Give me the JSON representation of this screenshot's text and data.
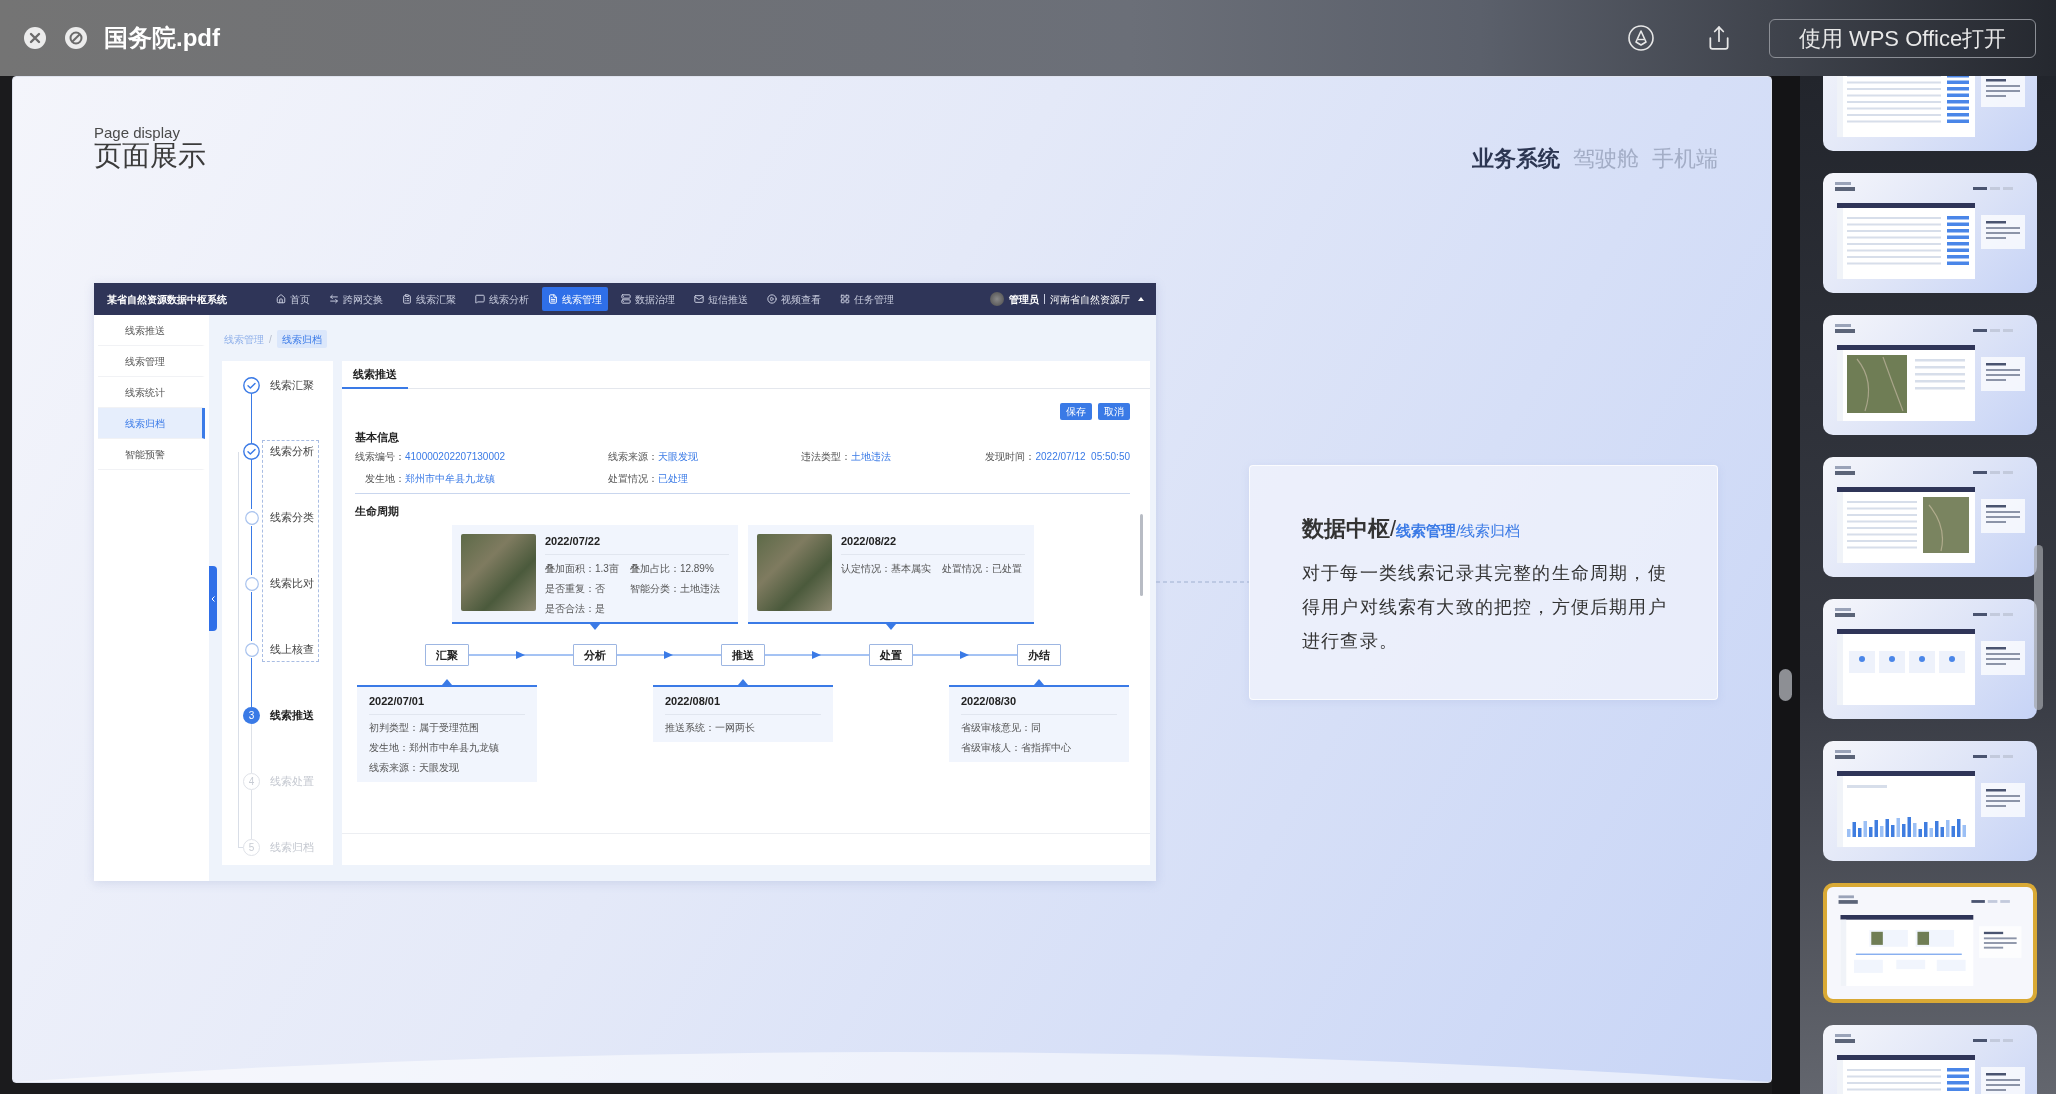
{
  "window": {
    "title": "国务院.pdf",
    "open_button": "使用 WPS Office打开"
  },
  "page": {
    "subtitle": "Page display",
    "title": "页面展示",
    "view_tabs": [
      {
        "label": "业务系统",
        "selected": true
      },
      {
        "label": "驾驶舱",
        "selected": false
      },
      {
        "label": "手机端",
        "selected": false
      }
    ],
    "app": {
      "system_name": "某省自然资源数据中枢系统",
      "nav": [
        {
          "label": "首页",
          "selected": false
        },
        {
          "label": "跨网交换",
          "selected": false
        },
        {
          "label": "线索汇聚",
          "selected": false
        },
        {
          "label": "线索分析",
          "selected": false
        },
        {
          "label": "线索管理",
          "selected": true
        },
        {
          "label": "数据治理",
          "selected": false
        },
        {
          "label": "短信推送",
          "selected": false
        },
        {
          "label": "视频查看",
          "selected": false
        },
        {
          "label": "任务管理",
          "selected": false
        }
      ],
      "user": {
        "name": "管理员",
        "org": "河南省自然资源厅"
      },
      "sidebar": [
        {
          "label": "线索推送",
          "selected": false
        },
        {
          "label": "线索管理",
          "selected": false
        },
        {
          "label": "线索统计",
          "selected": false
        },
        {
          "label": "线索归档",
          "selected": true
        },
        {
          "label": "智能预警",
          "selected": false
        }
      ],
      "breadcrumb": {
        "separator": "/",
        "items": [
          {
            "label": "线索管理",
            "selected": false
          },
          {
            "label": "线索归档",
            "selected": true
          }
        ]
      },
      "steps": [
        {
          "label": "线索汇聚",
          "kind": "done",
          "grouped": false
        },
        {
          "label": "线索分析",
          "kind": "done",
          "grouped": true
        },
        {
          "label": "线索分类",
          "kind": "open",
          "grouped": true
        },
        {
          "label": "线索比对",
          "kind": "open",
          "grouped": true
        },
        {
          "label": "线上核查",
          "kind": "open",
          "grouped": true
        },
        {
          "label": "线索推送",
          "kind": "current",
          "number": "3",
          "grouped": false
        },
        {
          "label": "线索处置",
          "kind": "pending",
          "number": "4",
          "grouped": false
        },
        {
          "label": "线索归档",
          "kind": "pending",
          "number": "5",
          "grouped": false
        }
      ],
      "tabs": [
        {
          "label": "线索推送",
          "selected": true
        }
      ],
      "actions": [
        "保存",
        "取消"
      ],
      "basic_info": {
        "title": "基本信息",
        "rows": [
          [
            {
              "label": "线索编号：",
              "value": "410000202207130002"
            },
            {
              "label": "线索来源：",
              "value": "天眼发现"
            },
            {
              "label": "违法类型：",
              "value": "土地违法"
            },
            {
              "label": "发现时间：",
              "value": "2022/07/12  05:50:50"
            }
          ],
          [
            {
              "label": "发生地：",
              "value": "郑州市中牟县九龙镇"
            },
            {
              "label": "处置情况：",
              "value": "已处理"
            }
          ]
        ]
      },
      "lifecycle": {
        "title": "生命周期",
        "stages": [
          {
            "label": "汇聚",
            "record": {
              "kind": "below",
              "date": "2022/07/01",
              "fields": [
                "初判类型：属于受理范围",
                "发生地：郑州市中牟县九龙镇",
                "线索来源：天眼发现"
              ]
            }
          },
          {
            "label": "分析",
            "record": {
              "kind": "above",
              "photo": true,
              "date": "2022/07/22",
              "fields": [
                "叠加面积：1.3亩",
                "叠加占比：12.89%",
                "是否重复：否",
                "智能分类：土地违法",
                "是否合法：是"
              ]
            }
          },
          {
            "label": "推送",
            "record": {
              "kind": "below",
              "date": "2022/08/01",
              "fields": [
                "推送系统：一网两长"
              ]
            }
          },
          {
            "label": "处置",
            "record": {
              "kind": "above",
              "photo": true,
              "date": "2022/08/22",
              "fields": [
                "认定情况：基本属实",
                "处置情况：已处置"
              ]
            }
          },
          {
            "label": "办结",
            "record": {
              "kind": "below",
              "date": "2022/08/30",
              "fields": [
                "省级审核意见：同",
                "省级审核人：省指挥中心"
              ]
            }
          }
        ]
      }
    },
    "note": {
      "title": "**数据中枢**/",
      "path": "**线索管理**/线索归档",
      "body": "对于每一类线索记录其完整的生命周期，使得用户对线索有大致的把控，方便后期用户进行查录。"
    }
  },
  "thumbnails": [
    {
      "kind": "table",
      "selected": false
    },
    {
      "kind": "table",
      "selected": false
    },
    {
      "kind": "map",
      "selected": false
    },
    {
      "kind": "split-map",
      "selected": false
    },
    {
      "kind": "cards",
      "selected": false
    },
    {
      "kind": "chart",
      "selected": false
    },
    {
      "kind": "timeline",
      "selected": true
    },
    {
      "kind": "table",
      "selected": false
    }
  ]
}
